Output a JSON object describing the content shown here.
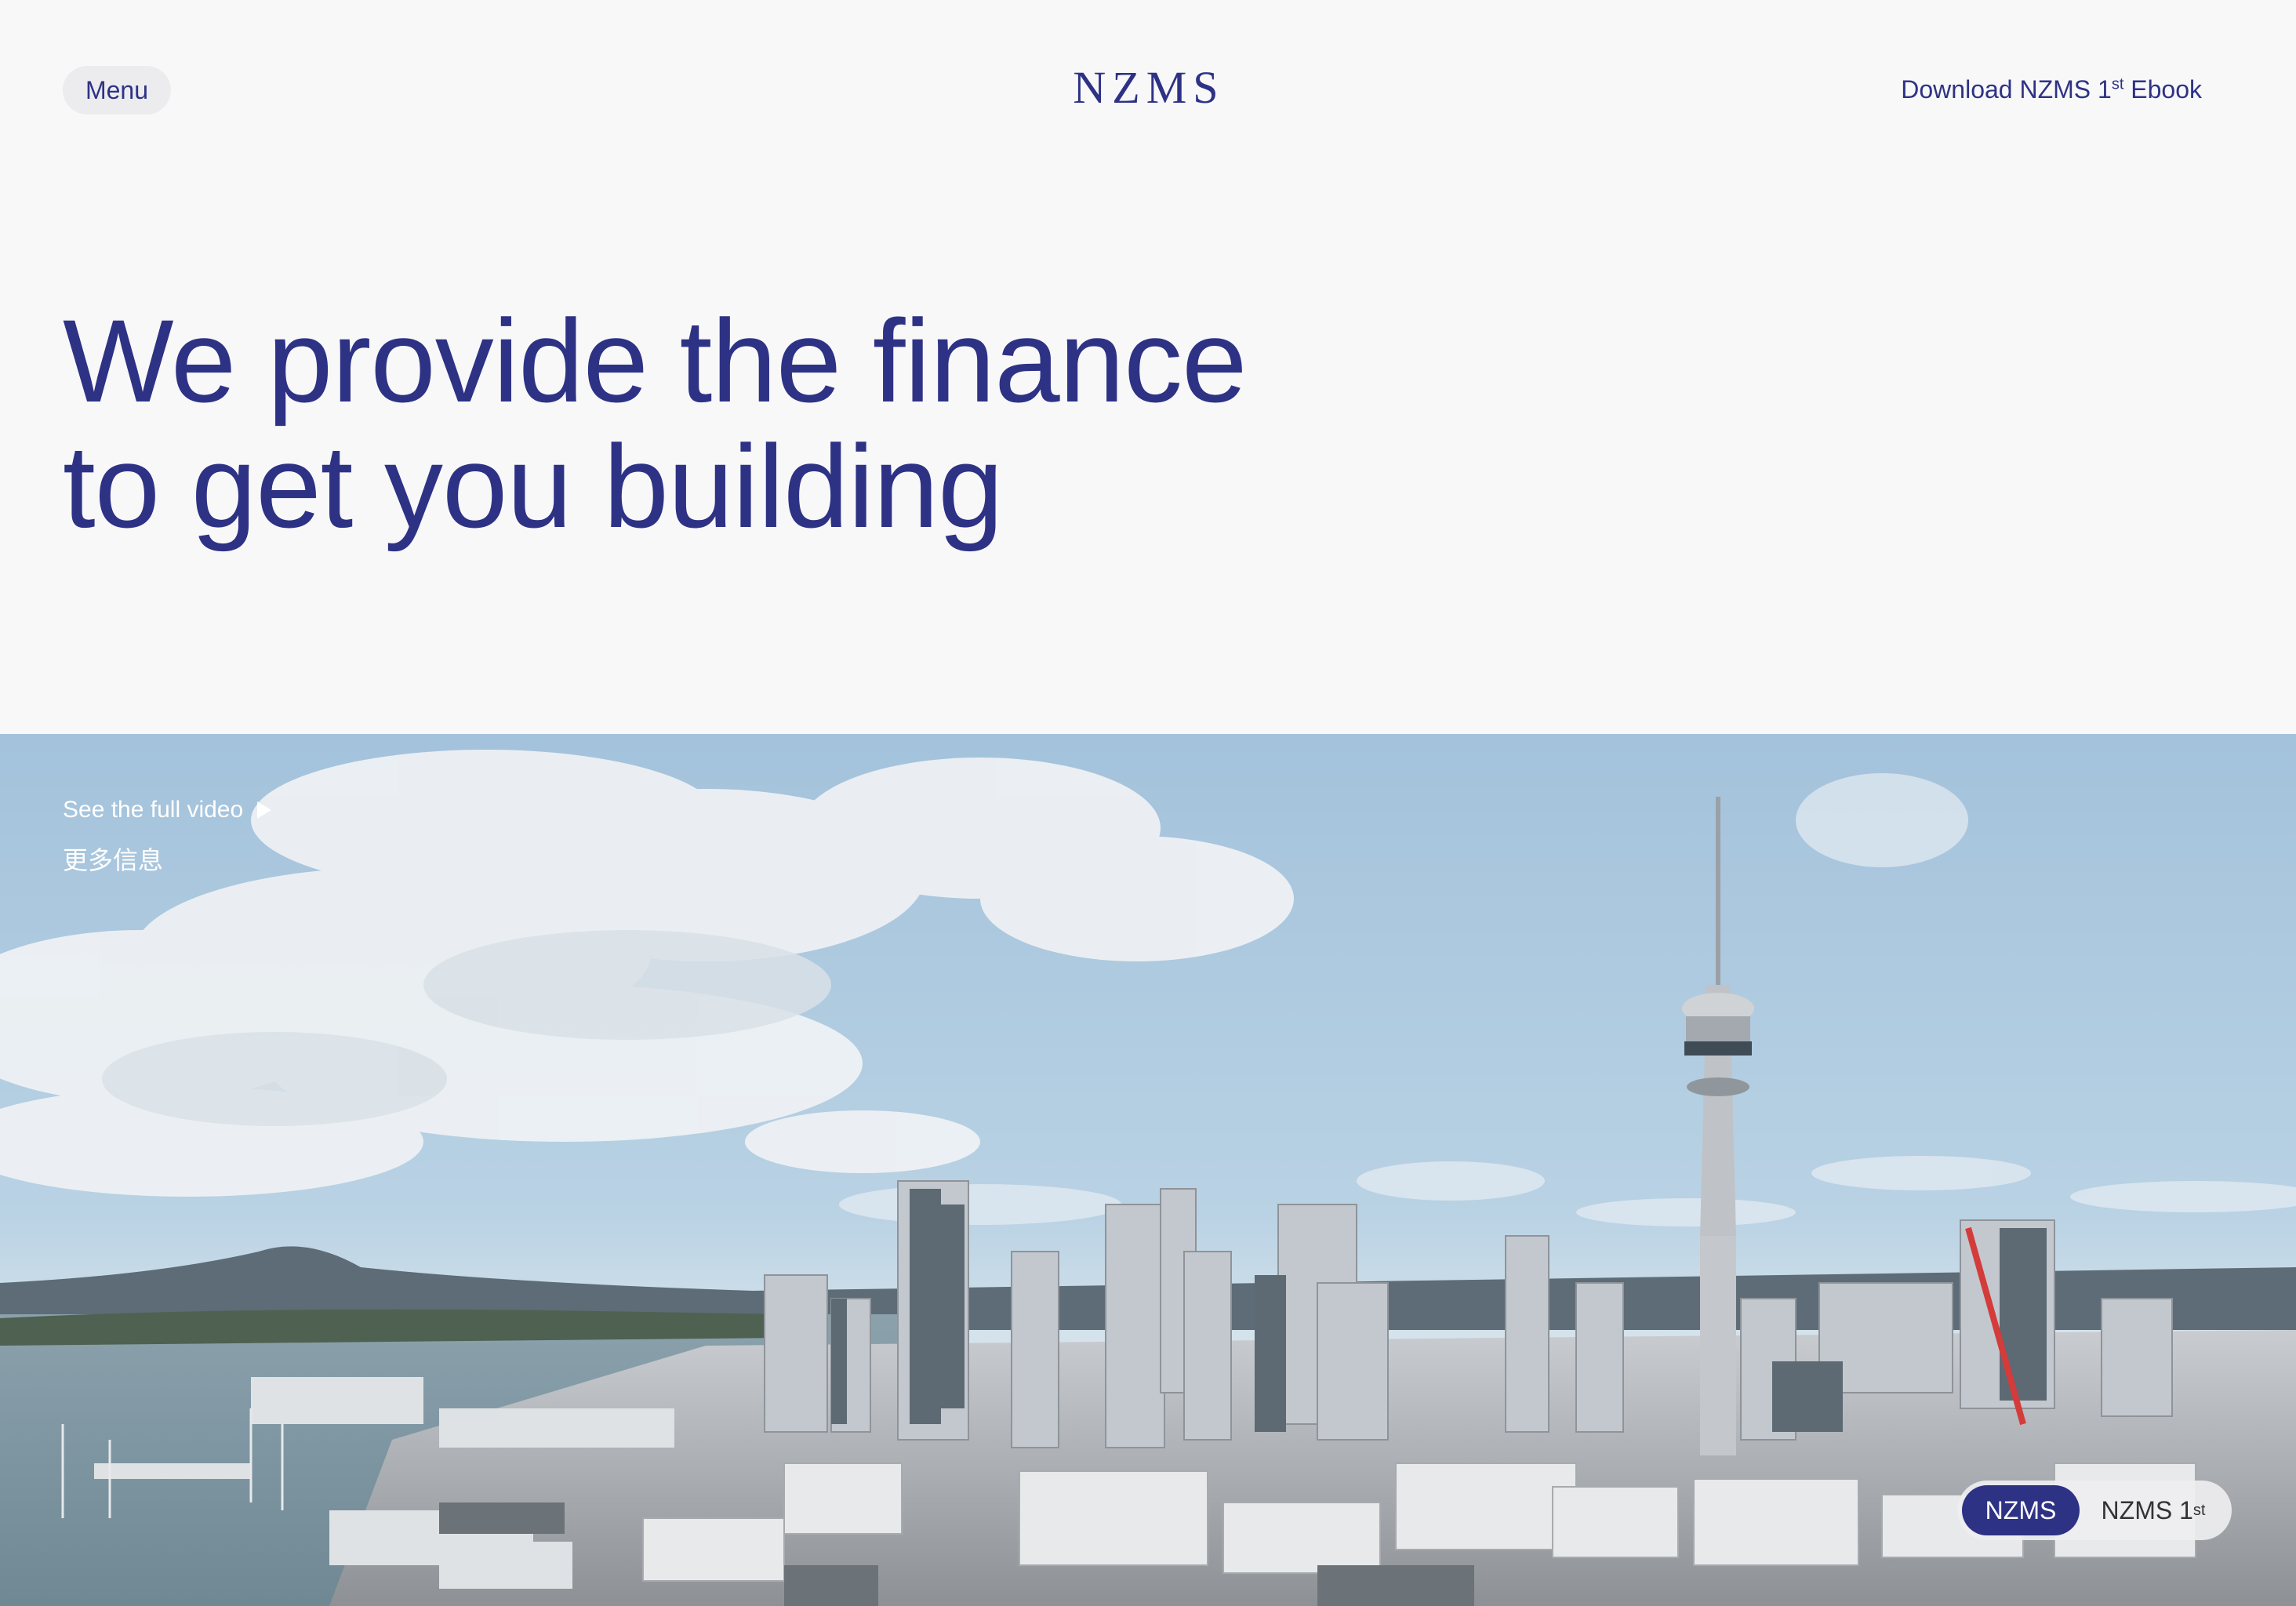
{
  "header": {
    "menu_label": "Menu",
    "logo_text": "NZMS",
    "download": {
      "prefix": "Download NZMS 1",
      "sup": "st",
      "suffix": " Ebook"
    }
  },
  "hero": {
    "title_line1": "We provide the finance",
    "title_line2": "to get you building"
  },
  "video": {
    "see_full_video": "See the full video",
    "more_info": "更多信息",
    "play_icon": "play-triangle-icon"
  },
  "toggle": {
    "option_active": "NZMS",
    "option_inactive_prefix": "NZMS 1",
    "option_inactive_sup": "st"
  },
  "colors": {
    "brand": "#2e3285",
    "background": "#f8f8f9",
    "menu_pill": "#ececee",
    "sky": "#a8c5dc"
  }
}
